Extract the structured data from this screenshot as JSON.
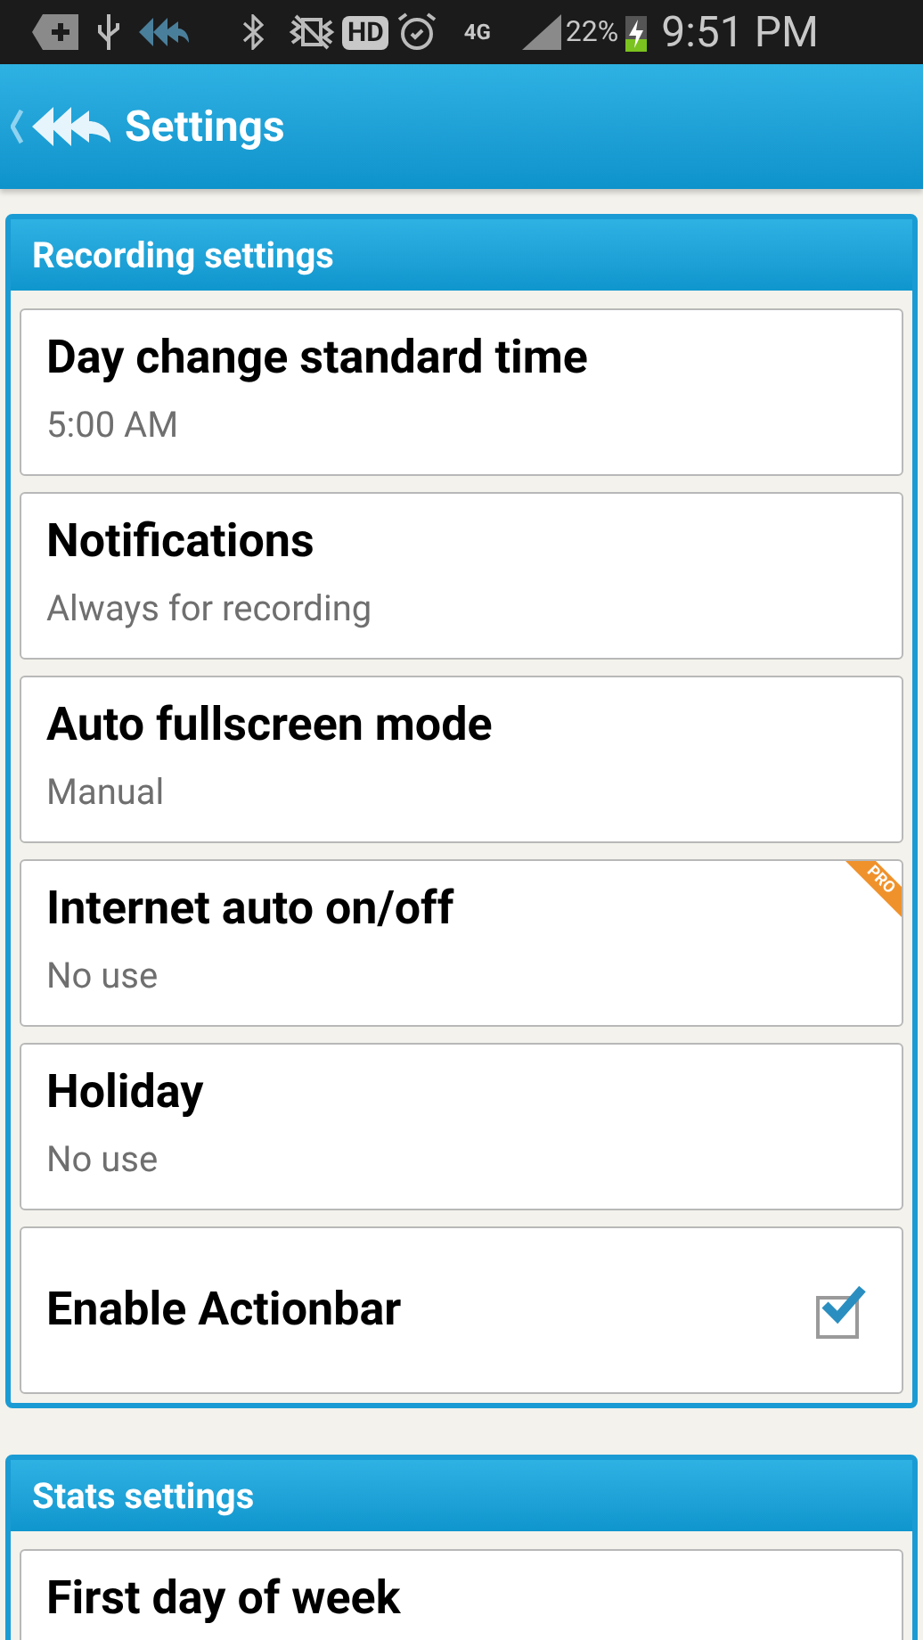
{
  "status_bar": {
    "hd": "HD",
    "network": "4G",
    "battery": "22%",
    "time": "9:51 PM"
  },
  "action_bar": {
    "title": "Settings"
  },
  "sections": [
    {
      "title": "Recording settings",
      "items": [
        {
          "kind": "value",
          "label": "Day change standard time",
          "value": "5:00 AM"
        },
        {
          "kind": "value",
          "label": "Notifications",
          "value": "Always for recording"
        },
        {
          "kind": "value",
          "label": "Auto fullscreen mode",
          "value": "Manual"
        },
        {
          "kind": "value",
          "label": "Internet auto on/off",
          "value": "No use",
          "badge": "PRO"
        },
        {
          "kind": "value",
          "label": "Holiday",
          "value": "No use"
        },
        {
          "kind": "checkbox",
          "label": "Enable Actionbar",
          "checked": true
        }
      ]
    },
    {
      "title": "Stats settings",
      "items": [
        {
          "kind": "value",
          "label": "First day of week"
        }
      ]
    }
  ]
}
